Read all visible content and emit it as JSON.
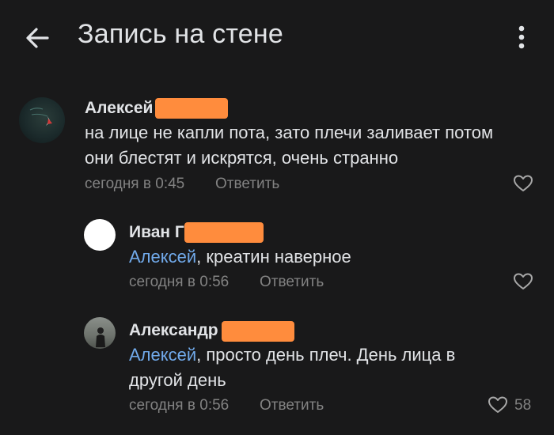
{
  "header": {
    "title": "Запись на стене"
  },
  "comments": [
    {
      "author": "Алексей",
      "text": "на лице не капли пота, зато плечи заливает потом они блестят и искрятся, очень странно",
      "time": "сегодня в 0:45",
      "reply_label": "Ответить"
    },
    {
      "author": "Иван Г",
      "mention": "Алексей",
      "text": ", креатин наверное",
      "time": "сегодня в 0:56",
      "reply_label": "Ответить"
    },
    {
      "author": "Александр",
      "mention": "Алексей",
      "text": ", просто день плеч. День лица в другой день",
      "time": "сегодня в 0:56",
      "reply_label": "Ответить",
      "likes": "58"
    }
  ],
  "colors": {
    "background": "#19191a",
    "text": "#e1e3e6",
    "secondary": "#828282",
    "mention": "#71aaeb",
    "redaction": "#ff8c3d"
  },
  "icons": [
    "back-arrow-icon",
    "more-vertical-icon",
    "heart-icon"
  ]
}
